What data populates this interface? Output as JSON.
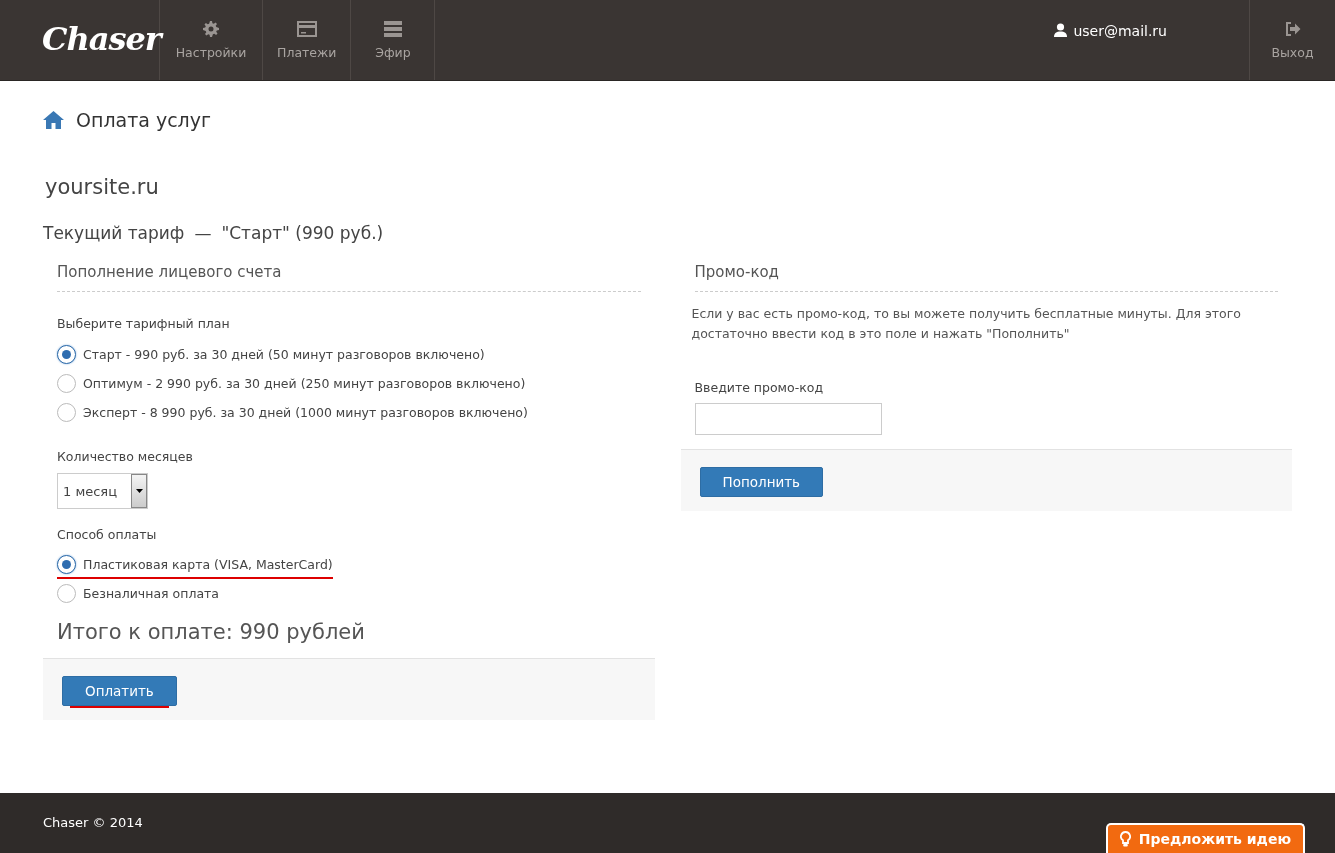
{
  "header": {
    "logo": "Chaser",
    "nav": [
      {
        "kind": "gear",
        "label": "Настройки"
      },
      {
        "kind": "card",
        "label": "Платежи"
      },
      {
        "kind": "server",
        "label": "Эфир"
      }
    ],
    "user": "user@mail.ru",
    "logout": "Выход"
  },
  "page_title": "Оплата услуг",
  "site": "yoursite.ru",
  "tariff": {
    "label": "Текущий тариф",
    "dash": "—",
    "value": "\"Старт\" (990 руб.)"
  },
  "payment_panel": {
    "title": "Пополнение лицевого счета",
    "plan_label": "Выберите тарифный план",
    "plans": [
      {
        "label": "Старт - 990 руб. за 30 дней (50 минут разговоров включено)",
        "selected": true
      },
      {
        "label": "Оптимум - 2 990 руб. за 30 дней (250 минут разговоров включено)",
        "selected": false
      },
      {
        "label": "Эксперт - 8 990 руб. за 30 дней (1000 минут разговоров включено)",
        "selected": false
      }
    ],
    "months_label": "Количество месяцев",
    "months_value": "1 месяц",
    "method_label": "Способ оплаты",
    "methods": [
      {
        "label": "Пластиковая карта (VISA, MasterCard)",
        "selected": true
      },
      {
        "label": "Безналичная оплата",
        "selected": false
      }
    ],
    "total": "Итого к оплате: 990 рублей",
    "button": "Оплатить"
  },
  "promo_panel": {
    "title": "Промо-код",
    "text": "Если у вас есть промо-код, то вы можете получить бесплатные минуты. Для этого достаточно ввести код в это поле и нажать \"Пополнить\"",
    "field_label": "Введите промо-код",
    "button": "Пополнить"
  },
  "footer": {
    "copyright": "Chaser © 2014",
    "idea_button": "Предложить идею"
  }
}
